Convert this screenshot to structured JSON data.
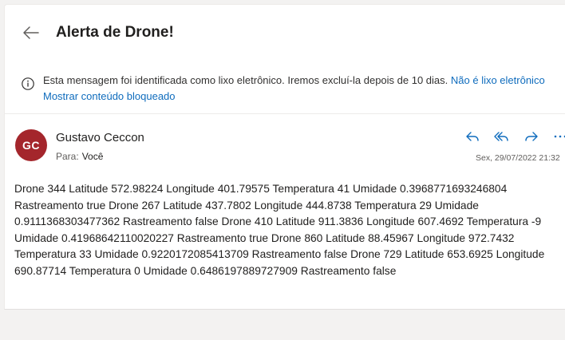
{
  "message": {
    "subject": "Alerta de Drone!",
    "junk_notice": "Esta mensagem foi identificada como lixo eletrônico. Iremos excluí-la depois de 10 dias.",
    "not_junk_link": "Não é lixo eletrônico",
    "show_blocked_link": "Mostrar conteúdo bloqueado",
    "sender": {
      "initials": "GC",
      "name": "Gustavo Ceccon",
      "avatar_color": "#a4262c"
    },
    "to_label": "Para:",
    "to_name": "Você",
    "date": "Sex, 29/07/2022 21:32",
    "body": "Drone 344 Latitude 572.98224 Longitude 401.79575 Temperatura 41 Umidade 0.3968771693246804 Rastreamento true Drone 267 Latitude 437.7802 Longitude 444.8738 Temperatura 29 Umidade 0.9111368303477362 Rastreamento false Drone 410 Latitude 911.3836 Longitude 607.4692 Temperatura -9 Umidade 0.41968642110020227 Rastreamento true Drone 860 Latitude 88.45967 Longitude 972.7432 Temperatura 33 Umidade 0.9220172085413709 Rastreamento false Drone 729 Latitude 653.6925 Longitude 690.87714 Temperatura 0 Umidade 0.6486197889727909 Rastreamento false"
  },
  "actions": {
    "reply_icon": "reply-icon",
    "reply_all_icon": "reply-all-icon",
    "forward_icon": "forward-icon",
    "more_icon": "more-icon"
  },
  "colors": {
    "link": "#0f6cbd",
    "accent": "#0f6cbd",
    "background": "#f3f2f1"
  }
}
